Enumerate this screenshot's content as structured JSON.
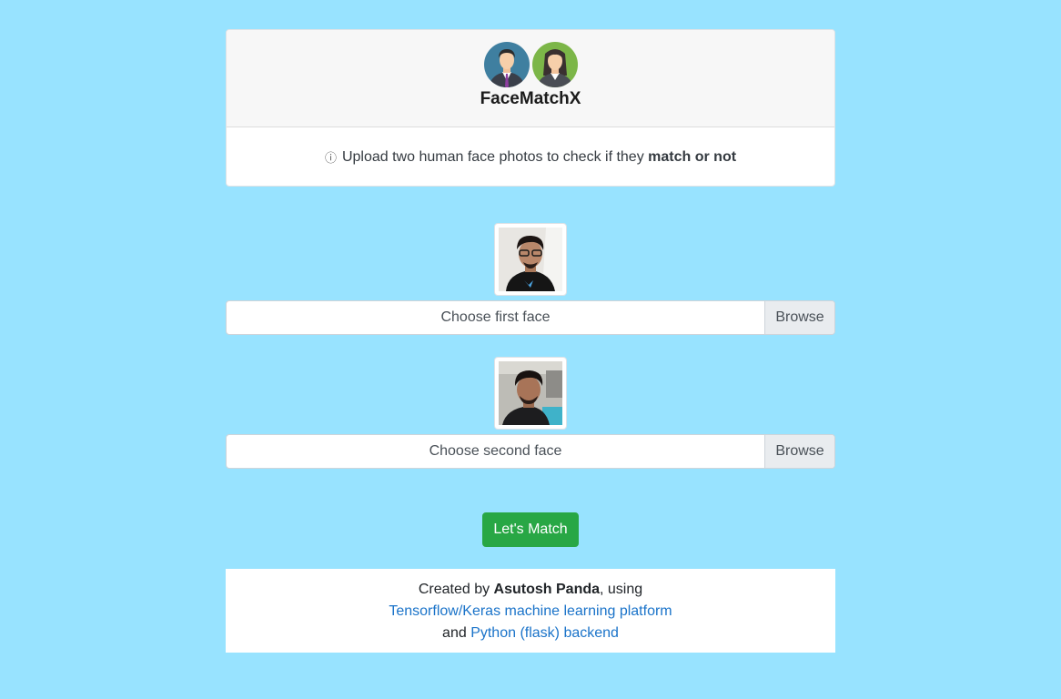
{
  "header": {
    "brand": "FaceMatchX",
    "avatar_icons": [
      "male-avatar-icon",
      "female-avatar-icon"
    ]
  },
  "info": {
    "icon": "ⓘ",
    "text": "Upload two human face photos to check if they ",
    "emphasis": "match or not"
  },
  "uploads": [
    {
      "placeholder": "Choose first face",
      "browse_label": "Browse"
    },
    {
      "placeholder": "Choose second face",
      "browse_label": "Browse"
    }
  ],
  "match_button": "Let's Match",
  "footer": {
    "prefix": "Created by ",
    "author": "Asutosh Panda",
    "suffix": ", using",
    "link1": "Tensorflow/Keras machine learning platform",
    "and": "and ",
    "link2": "Python (flask) backend"
  },
  "colors": {
    "page_bg": "#98e3ff",
    "button": "#28a745",
    "link": "#1a73c9"
  }
}
